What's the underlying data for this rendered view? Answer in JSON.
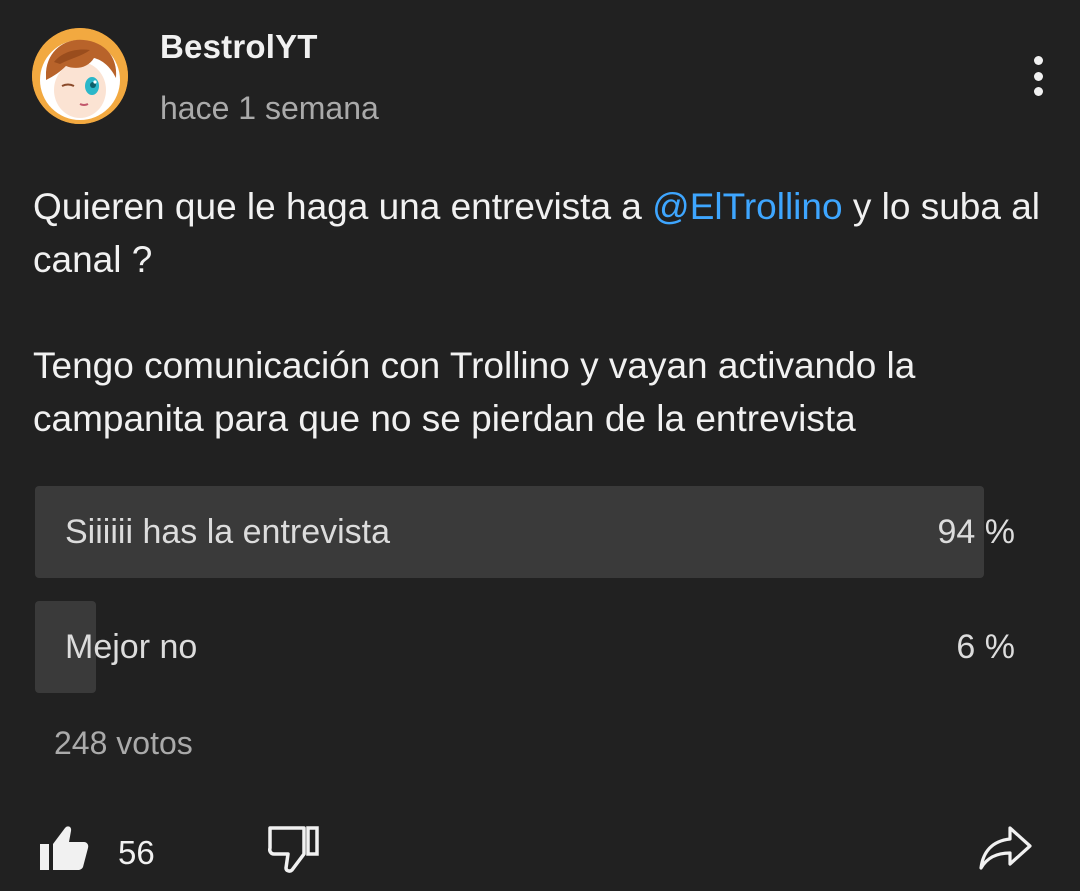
{
  "post": {
    "author": "BestrolYT",
    "timestamp": "hace 1 semana",
    "text_line1_before": "Quieren que le haga una entrevista a ",
    "mention": "@ElTrollino",
    "text_line1_after": " y lo suba al canal ?",
    "text_paragraph2": "Tengo comunicación con Trollino y vayan activando la campanita para que no se pierdan de la entrevista"
  },
  "poll": {
    "options": [
      {
        "label": "Siiiiii has la entrevista",
        "percent_text": "94 %",
        "percent": 94
      },
      {
        "label": "Mejor no",
        "percent_text": "6 %",
        "percent": 6
      }
    ],
    "votes": "248 votos"
  },
  "actions": {
    "like_count": "56",
    "like_icon": "thumbs-up-filled-icon",
    "dislike_icon": "thumbs-down-outline-icon",
    "share_icon": "share-arrow-icon",
    "menu_icon": "more-vertical-icon"
  },
  "colors": {
    "background": "#212121",
    "mention": "#3ea6ff",
    "poll_fill": "#3a3a3a",
    "secondary_text": "#aaaaaa"
  }
}
